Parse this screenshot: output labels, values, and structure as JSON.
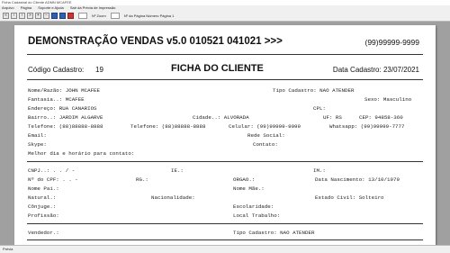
{
  "window": {
    "title": "Ficha Cadastral do Cliente ADMN MCAFEE"
  },
  "menu": [
    "Arquivo",
    "Página",
    "Suporte e Ajuda",
    "Sair da Prévia de Impressão"
  ],
  "toolbar": {
    "zoom_label": "Nº Zoom",
    "page_label": "Nº da Página Número Página 1"
  },
  "status": {
    "text": "Prévia"
  },
  "header": {
    "title": "DEMONSTRAÇÃO VENDAS v5.0 010521 041021 >>>",
    "phone": "(99)99999-9999",
    "code_label": "Código Cadastro:",
    "code_value": "19",
    "form_title": "FICHA DO CLIENTE",
    "date": "Data Cadastro: 23/07/2021"
  },
  "fields": {
    "nome": "Nome/Razão: JOHN MCAFEE",
    "tipo": "Tipo Cadastro: NAO ATENDER",
    "fantasia": "Fantasia..: MCAFEE",
    "sexo": "Sexo: Masculino",
    "endereco": "Endereço: RUA CANARIOS",
    "cpl": "CPL:",
    "bairro": "Bairro..: JARDIM ALGARVE",
    "cidade": "Cidade..: ALVORADA",
    "uf": "UF: RS",
    "cep": "CEP: 94858-360",
    "telefone": "Telefone: (88)88888-8888",
    "telefone2": "Telefone: (88)88888-8888",
    "celular": "Celular: (99)99999-9999",
    "whatsapp": "Whatsapp: (99)99999-7777",
    "email": "Email:",
    "rede": "Rede Social:",
    "skype": "Skype:",
    "contato": "Contato:",
    "melhor": "Melhor dia e horário para contato:",
    "cnpj": "CNPJ..:    .   .   /    -",
    "ie": "IE.:",
    "im": "IM.:",
    "cpf": "Nº do CPF:    .   .   -",
    "rg": "RG.:",
    "orgao": "ORGAO.:",
    "nascimento": "Data Nascimento: 13/10/1979",
    "pai": "Nome Pai.:",
    "mae": "Nome Mãe.:",
    "natural": "Natural.:",
    "nacionalidade": "Nacionalidade:",
    "civil": "Estado Civil: Solteiro",
    "conjuge": "Cônjuge.:",
    "escolaridade": "Escolaridade:",
    "profissao": "Profissão:",
    "trabalho": "Local Trabalho:",
    "vendedor": "Vendedor.:",
    "tipo2": "Tipo Cadastro: NAO ATENDER"
  }
}
